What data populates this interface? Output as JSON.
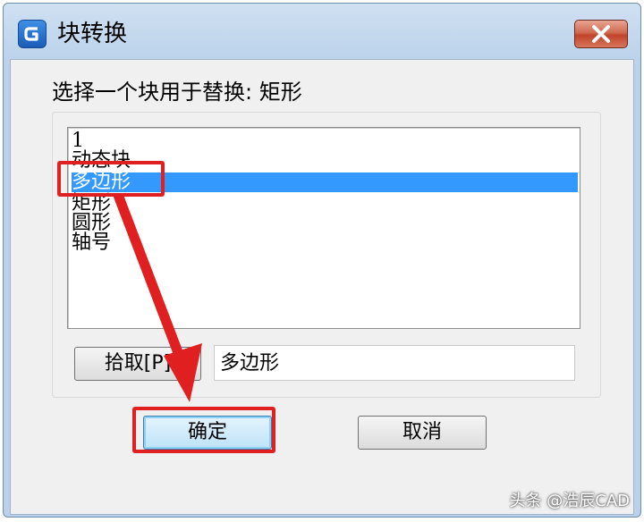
{
  "window": {
    "title": "块转换",
    "close_symbol": "✕"
  },
  "prompt": "选择一个块用于替换: 矩形",
  "block_list": {
    "items": [
      "1",
      "动态块",
      "多边形",
      "矩形",
      "圆形",
      "轴号"
    ],
    "selected_index": 2
  },
  "pick_button": {
    "label": "拾取[P]"
  },
  "name_field": {
    "value": "多边形"
  },
  "ok_button": {
    "label": "确定"
  },
  "cancel_button": {
    "label": "取消"
  },
  "annotation": {
    "color": "#e02020"
  },
  "watermark": "头条 @浩辰CAD",
  "icons": {
    "app": "gstarcad-g-icon",
    "close": "close-icon",
    "arrow": "annotation-arrow"
  }
}
